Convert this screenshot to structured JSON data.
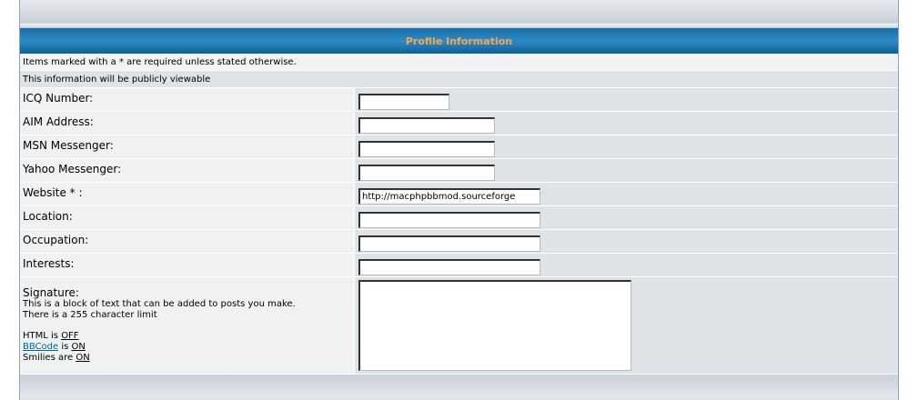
{
  "header": {
    "title": "Profile Information"
  },
  "notes": {
    "required": "Items marked with a * are required unless stated otherwise.",
    "public": "This information will be publicly viewable"
  },
  "fields": {
    "icq": {
      "label": "ICQ Number:",
      "value": ""
    },
    "aim": {
      "label": "AIM Address:",
      "value": ""
    },
    "msn": {
      "label": "MSN Messenger:",
      "value": ""
    },
    "yahoo": {
      "label": "Yahoo Messenger:",
      "value": ""
    },
    "website": {
      "label": "Website * :",
      "value": "http://macphpbbmod.sourceforge"
    },
    "location": {
      "label": "Location:",
      "value": ""
    },
    "occupation": {
      "label": "Occupation:",
      "value": ""
    },
    "interests": {
      "label": "Interests:",
      "value": ""
    }
  },
  "signature": {
    "label": "Signature:",
    "help_line1": "This is a block of text that can be added to posts you make.",
    "help_line2": "There is a 255 character limit",
    "html_prefix": "HTML is ",
    "html_state": "OFF",
    "bbcode_link": "BBCode",
    "bbcode_mid": " is ",
    "bbcode_state": "ON",
    "smilies_prefix": "Smilies are ",
    "smilies_state": "ON",
    "value": ""
  }
}
